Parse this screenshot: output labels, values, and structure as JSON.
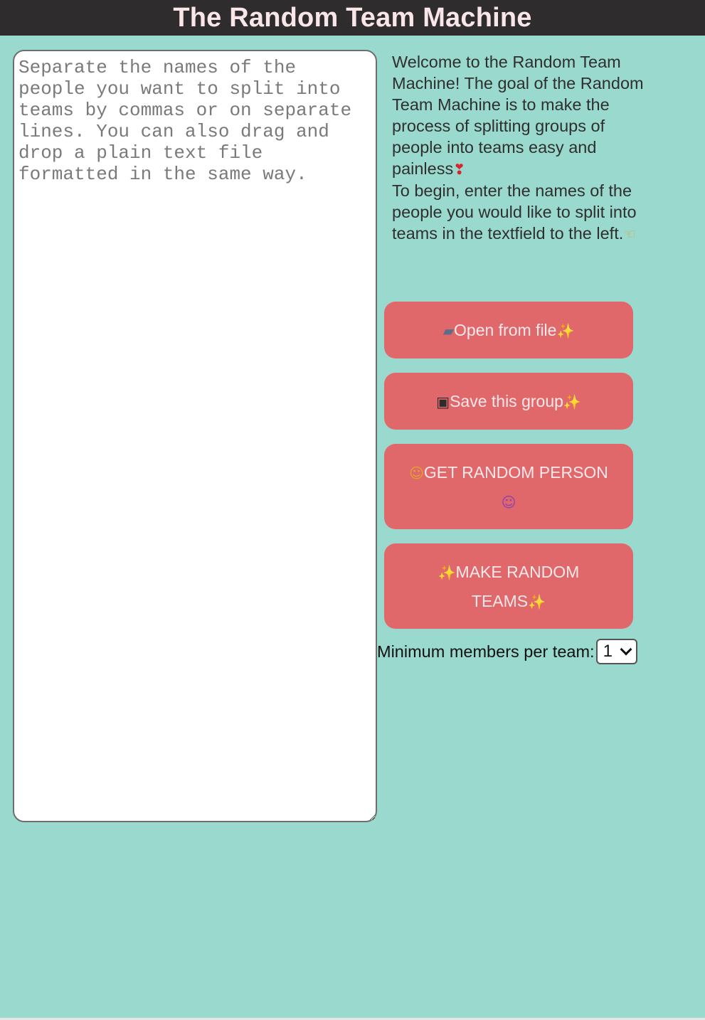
{
  "header": {
    "title": "The Random Team Machine"
  },
  "names_input": {
    "placeholder": "Separate the names of the people you want to split into teams by commas or on separate lines. You can also drag and drop a plain text file formatted in the same way.",
    "value": ""
  },
  "welcome": {
    "paragraph1": "Welcome to the Random Team Machine! The goal of the Random Team Machine is to make the process of splitting groups of people into teams easy and painless",
    "paragraph1_emoji": "❣",
    "paragraph2": "To begin, enter the names of the people you would like to split into teams in the textfield to the left.",
    "paragraph2_emoji": "☜"
  },
  "buttons": {
    "open_file": {
      "icon": "folder-icon",
      "icon_glyph": "▰",
      "label": "Open from file",
      "sparkle": "✨"
    },
    "save_group": {
      "icon": "floppy-disk-icon",
      "icon_glyph": "▣",
      "label": "Save this group",
      "sparkle": "✨"
    },
    "random_person": {
      "icon": "person-raising-hand-icon",
      "icon_glyph": "☺",
      "label": "GET RANDOM PERSON",
      "icon_end": "woman-raising-hand-icon",
      "icon_end_glyph": "☺"
    },
    "make_teams": {
      "sparkle_start": "✨",
      "label": "MAKE RANDOM TEAMS",
      "sparkle_end": "✨"
    }
  },
  "min_members": {
    "label": "Minimum members per team:",
    "selected": "1"
  },
  "colors": {
    "background": "#9ad9ce",
    "header_bg": "#2f2c2d",
    "header_text": "#f8e6e8",
    "button_bg": "#e0686b",
    "button_text": "#fbe8ea",
    "sparkle": "#f5c542"
  }
}
